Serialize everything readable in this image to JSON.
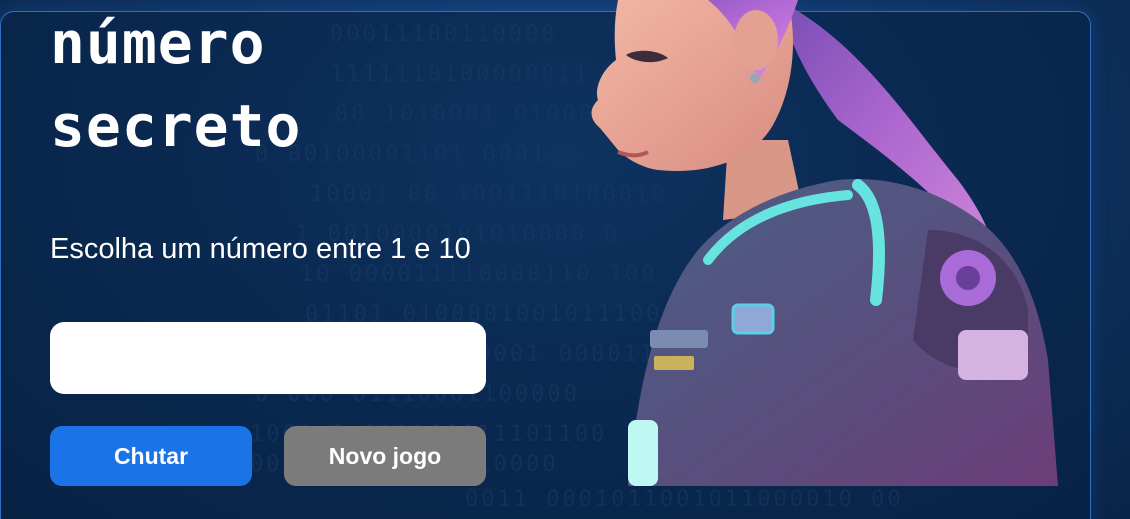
{
  "title_lines": [
    "número",
    "secreto"
  ],
  "instruction": "Escolha um número entre 1 e 10",
  "input": {
    "value": "",
    "placeholder": ""
  },
  "buttons": {
    "guess_label": "Chutar",
    "new_game_label": "Novo jogo"
  },
  "colors": {
    "guess_button": "#1a74e8",
    "new_game_button": "#7b7b7b",
    "background": "#0f3566",
    "border": "#2f6fc1"
  },
  "illustration": {
    "icon": "cyberpunk-girl-illustration"
  },
  "background_code": [
    "00011100110000",
    "1111110100000011",
    "00 1010001 01000",
    "0 00100001101 0001",
    "10001 00 1001110100010",
    "1 0010000101010000 0",
    "10 000011110000110 100",
    "01101 010000100101110000",
    "1 0110000011100001 000011",
    "0 000 01110001100000",
    "1001 0 011100011101100",
    "000 000100101010000",
    "0011 0001011001011000010 00"
  ]
}
